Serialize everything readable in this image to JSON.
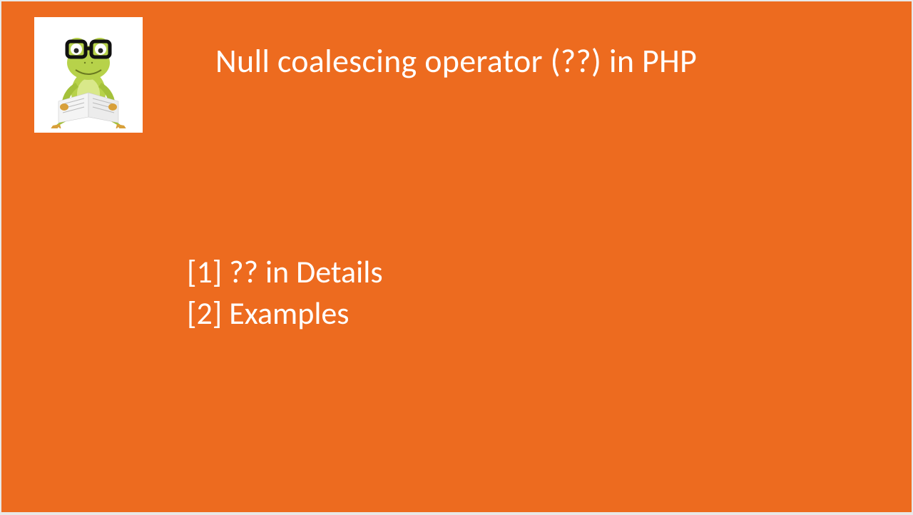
{
  "slide": {
    "title": "Null coalescing operator (??) in PHP",
    "agenda": {
      "item1": "[1] ?? in Details",
      "item2": "[2] Examples"
    }
  }
}
